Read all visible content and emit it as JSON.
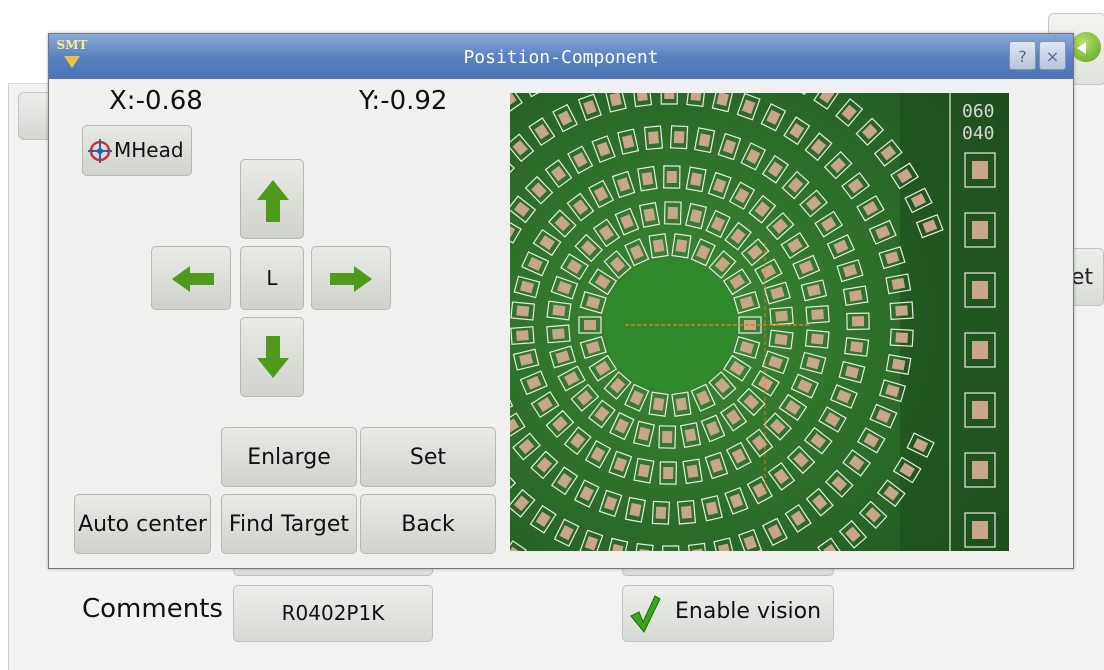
{
  "background": {
    "right_button_partial_label": "et",
    "comments_label": "Comments",
    "comments_value": "R0402P1K",
    "enable_vision_label": "Enable vision"
  },
  "dialog": {
    "logo_text": "SMT",
    "title": "Position-Component",
    "help_label": "?",
    "close_label": "×",
    "x_coord": "X:-0.68",
    "y_coord": "Y:-0.92",
    "head_button_label": "MHead",
    "center_button_label": "L",
    "buttons": {
      "enlarge": "Enlarge",
      "set": "Set",
      "auto_center": "Auto center",
      "find_target": "Find Target",
      "back": "Back"
    },
    "camera_overlay_text": [
      "060",
      "040"
    ]
  },
  "colors": {
    "title_bar": "#5b82c0",
    "arrow_green": "#4f9a1c",
    "pcb_green": "#2c6a28",
    "crosshair": "#e07a2a"
  },
  "icons": [
    "arrow-up-icon",
    "arrow-left-icon",
    "arrow-right-icon",
    "arrow-down-icon",
    "target-icon",
    "checkmark-icon",
    "help-icon",
    "close-icon",
    "go-back-icon"
  ]
}
